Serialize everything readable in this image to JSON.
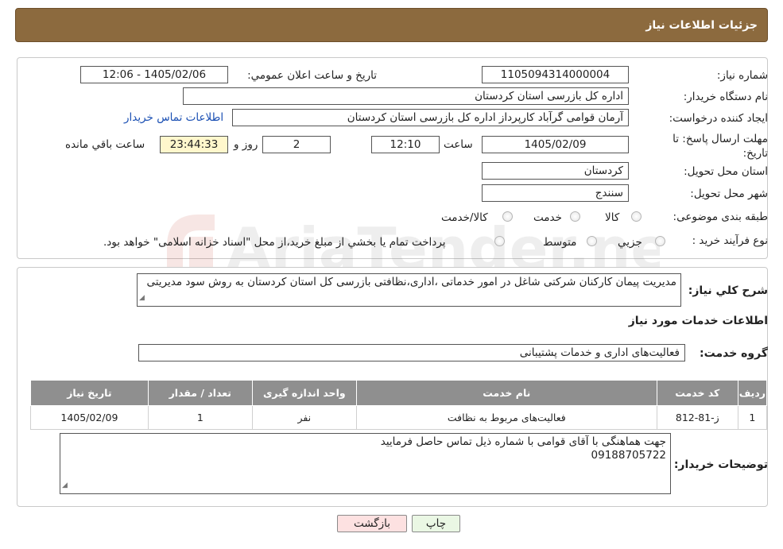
{
  "header": {
    "title": "جزئیات اطلاعات نیاز"
  },
  "form": {
    "need_number_label": "شماره نیاز:",
    "need_number": "1105094314000004",
    "announce_label": "تاريخ و ساعت اعلان عمومي:",
    "announce_value": "1405/02/06 - 12:06",
    "buyer_org_label": "نام دستگاه خريدار:",
    "buyer_org": "اداره کل بازرسی استان کردستان",
    "creator_label": "ايجاد کننده درخواست:",
    "creator": "آرمان قوامی گرآباد کارپرداز اداره کل بازرسی استان کردستان",
    "contact_link": "اطلاعات تماس خريدار",
    "deadline_label": "مهلت ارسال پاسخ: تا تاريخ:",
    "deadline_date": "1405/02/09",
    "time_label": "ساعت",
    "deadline_time": "12:10",
    "days_value": "2",
    "days_label": "روز و",
    "remaining_value": "23:44:33",
    "remaining_label": "ساعت باقي مانده",
    "province_label": "استان محل تحويل:",
    "province": "کردستان",
    "city_label": "شهر محل تحويل:",
    "city": "سنندج",
    "category_label": "طبقه بندی موضوعی:",
    "category_options": [
      "کالا",
      "خدمت",
      "کالا/خدمت"
    ],
    "process_label": "نوع فرآيند خريد :",
    "process_options": [
      "جزيي",
      "متوسط"
    ],
    "process_note": "پرداخت تمام يا بخشي از مبلغ خريد،از محل \"اسناد خزانه اسلامی\" خواهد بود."
  },
  "description": {
    "label": "شرح کلي نياز:",
    "text": "مدیریت پیمان کارکنان شرکتی شاغل در امور خدماتی ،اداری،نظافتی بازرسی کل استان کردستان به روش سود مدیریتی"
  },
  "services": {
    "section_title": "اطلاعات خدمات مورد نياز",
    "group_label": "گروه خدمت:",
    "group_value": "فعاليت‌های اداری و خدمات پشتيبانی",
    "columns": [
      "رديف",
      "کد خدمت",
      "نام خدمت",
      "واحد اندازه گيری",
      "تعداد / مقدار",
      "تاريخ نياز"
    ],
    "rows": [
      [
        "1",
        "ز-81-812",
        "فعاليت‌های مربوط به نظافت",
        "نفر",
        "1",
        "1405/02/09"
      ]
    ]
  },
  "buyer_notes": {
    "label": "توضيحات خريدار:",
    "line1": "جهت هماهنگی با آقای قوامی با شماره ذیل تماس حاصل فرمایید",
    "line2": "09188705722"
  },
  "buttons": {
    "print": "چاپ",
    "back": "بازگشت"
  },
  "watermark": {
    "text": "AriaTender.neT"
  },
  "colors": {
    "header_bg": "#8c6a3e",
    "table_header_bg": "#8f8f8f",
    "link": "#1a4fb3",
    "back_button_bg": "#fde1e1",
    "print_button_bg": "#eaf7e4"
  }
}
